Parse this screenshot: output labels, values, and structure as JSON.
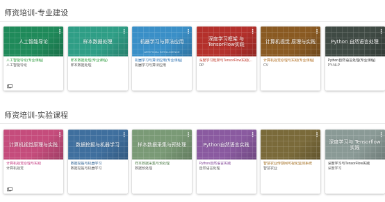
{
  "sections": [
    {
      "title": "师资培训-专业建设",
      "cards": [
        {
          "thumb_title": "人工智能导论",
          "thumb_sub": "",
          "course": "人工智能导论(专业课程)",
          "subtitle": "人工智能导论",
          "color": "#1f8a5a",
          "course_color": "#2a9a3a",
          "show_footer_icon": true
        },
        {
          "thumb_title": "样本数据处理",
          "thumb_sub": "",
          "course": "样本数据处理(专业课程)",
          "subtitle": "样本数据处理",
          "color": "#2f9e86",
          "course_color": "#2a9a3a",
          "show_footer_icon": false
        },
        {
          "thumb_title": "机器学习与算法应用",
          "thumb_sub": "ARTIFICIAL INTELLIGENCE",
          "course": "机器学习与算法应用(专业课程)",
          "subtitle": "机器学习与算法应用",
          "color": "#3a8fc7",
          "course_color": "#2a6fb0",
          "show_footer_icon": false
        },
        {
          "thumb_title": "深度学习框架 与TensorFlow实践",
          "thumb_sub": "",
          "course": "深度学习框架与TensorFlow实践(...",
          "subtitle": "DP",
          "color": "#b4302b",
          "course_color": "#c0392b",
          "show_footer_icon": false
        },
        {
          "thumb_title": "计算机视觉 原理与实践",
          "thumb_sub": "",
          "course": "计算机视觉原理与实践(专业课程)",
          "subtitle": "CV",
          "color": "#8a5a22",
          "course_color": "#b06a1a",
          "show_footer_icon": false
        },
        {
          "thumb_title": "Python 自然语言处理",
          "thumb_sub": "",
          "course": "Python自然语言处理(专业课程)",
          "subtitle": "PY-NLP",
          "color": "#3f4a44",
          "course_color": "#333333",
          "show_footer_icon": false
        }
      ]
    },
    {
      "title": "师资培训-实验课程",
      "cards": [
        {
          "thumb_title": "计算机视觉原理与实践",
          "thumb_sub": "",
          "course": "计算机视觉原理与实践",
          "subtitle": "计算机视觉",
          "color": "#c54c7c",
          "course_color": "#c0307a",
          "show_footer_icon": true
        },
        {
          "thumb_title": "数据挖掘与机器学习",
          "thumb_sub": "",
          "course": "数据挖掘与机器学习",
          "subtitle": "数据挖掘与机器学习",
          "color": "#3f6f9e",
          "course_color": "#2a5f90",
          "show_footer_icon": false
        },
        {
          "thumb_title": "样本数据采集与预处理",
          "thumb_sub": "",
          "course": "样本数据采集与预处理",
          "subtitle": "数据预处理",
          "color": "#7a9a76",
          "course_color": "#4a7a44",
          "show_footer_icon": false
        },
        {
          "thumb_title": "Python自然语言实践",
          "thumb_sub": "",
          "course": "Python自然语言实践",
          "subtitle": "自然语言处理",
          "color": "#8a5aa0",
          "course_color": "#7a3a90",
          "show_footer_icon": false
        },
        {
          "thumb_title": "",
          "thumb_sub": "",
          "course": "智慧农业传感网可视化监测系统",
          "subtitle": "智慧农业",
          "color": "#7a6a3a",
          "course_color": "#a06a1a",
          "show_footer_icon": false
        },
        {
          "thumb_title": "深度学习与 Tensorflow实践",
          "thumb_sub": "",
          "course": "深度学习与TensorFlow实践",
          "subtitle": "深度学习",
          "color": "#8a9a96",
          "course_color": "#333333",
          "show_footer_icon": false
        }
      ]
    }
  ],
  "icons": {
    "card_menu": "more-vert-icon",
    "card_footer": "folder-icon"
  }
}
